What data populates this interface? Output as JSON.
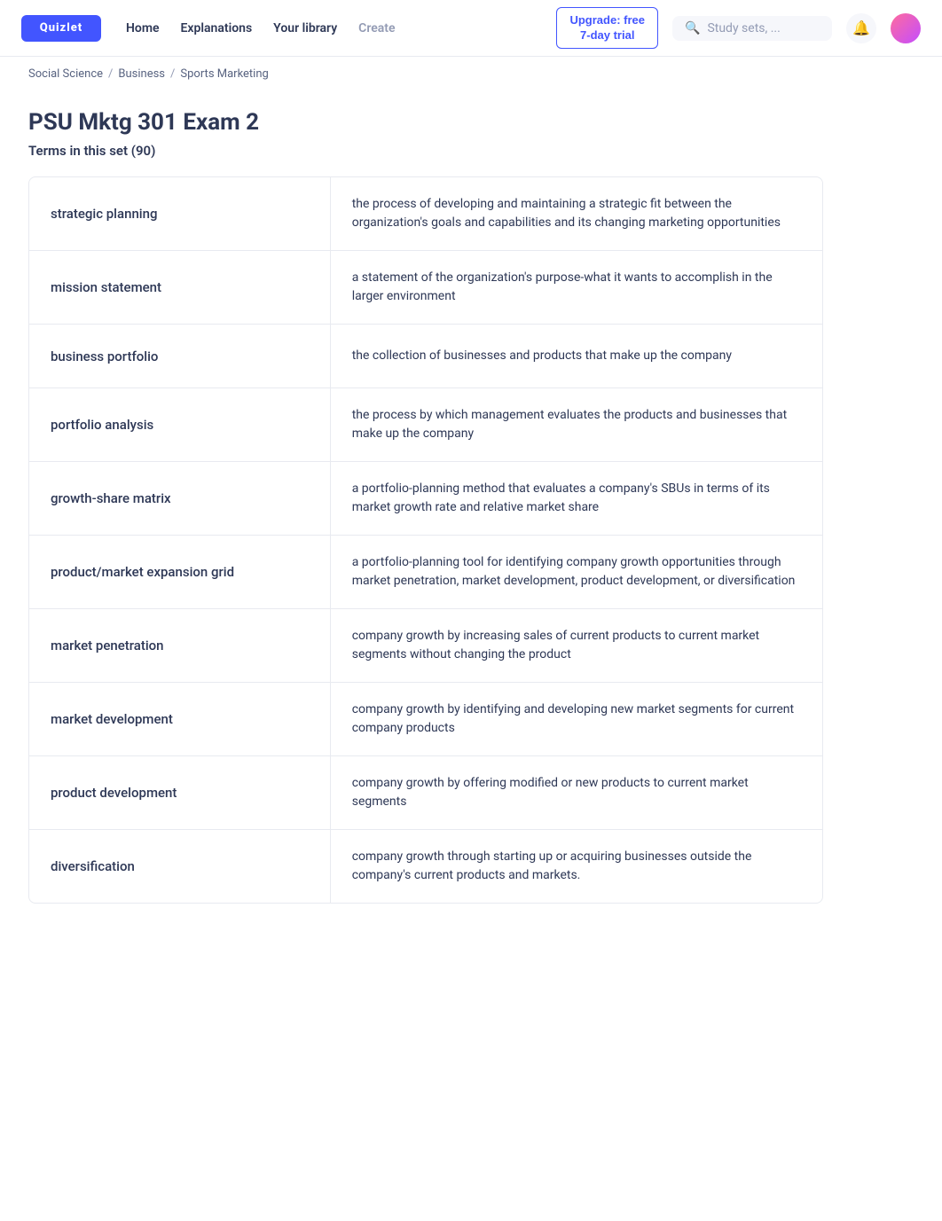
{
  "nav": {
    "logo_text": "Quizlet",
    "links": [
      {
        "label": "Home",
        "name": "home"
      },
      {
        "label": "Explanations",
        "name": "explanations"
      },
      {
        "label": "Your library",
        "name": "library"
      },
      {
        "label": "Create",
        "name": "create",
        "muted": true
      }
    ],
    "upgrade": "Upgrade: free\n7-day trial",
    "search_placeholder": "Study sets, ...",
    "bell": "🔔"
  },
  "breadcrumb": {
    "items": [
      "Social Science",
      "Business",
      "Sports Marketing"
    ]
  },
  "page": {
    "title": "PSU Mktg 301 Exam 2",
    "terms_label": "Terms in this set (90)"
  },
  "terms": [
    {
      "term": "strategic planning",
      "definition": "the process of developing and maintaining a strategic fit between the organization's goals and capabilities and its changing marketing opportunities"
    },
    {
      "term": "mission statement",
      "definition": "a statement of the organization's purpose-what it wants to accomplish in the larger environment"
    },
    {
      "term": "business portfolio",
      "definition": "the collection of businesses and products that make up the company"
    },
    {
      "term": "portfolio analysis",
      "definition": "the process by which management evaluates the products and businesses that make up the company"
    },
    {
      "term": "growth-share matrix",
      "definition": "a portfolio-planning method that evaluates a company's SBUs in terms of its market growth rate and relative market share"
    },
    {
      "term": "product/market expansion grid",
      "definition": "a portfolio-planning tool for identifying company growth opportunities through market penetration, market development, product development, or diversification"
    },
    {
      "term": "market penetration",
      "definition": "company growth by increasing sales of current products to current market segments without changing the product"
    },
    {
      "term": "market development",
      "definition": "company growth by identifying and developing new market segments for current company products"
    },
    {
      "term": "product development",
      "definition": "company growth by offering modified or new products to current market segments"
    },
    {
      "term": "diversification",
      "definition": "company growth through starting up or acquiring businesses outside the company's current products and markets."
    }
  ]
}
